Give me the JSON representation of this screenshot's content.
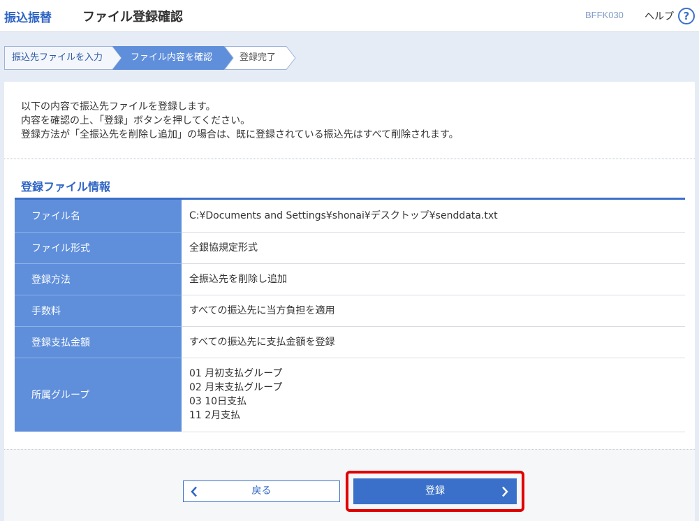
{
  "header": {
    "brand": "振込振替",
    "title": "ファイル登録確認",
    "screen_id": "BFFK030",
    "help_label": "ヘルプ",
    "help_icon": "?"
  },
  "steps": [
    {
      "label": "振込先ファイルを入力",
      "state": "done"
    },
    {
      "label": "ファイル内容を確認",
      "state": "current"
    },
    {
      "label": "登録完了",
      "state": "todo"
    }
  ],
  "intro": {
    "line1": "以下の内容で振込先ファイルを登録します。",
    "line2": "内容を確認の上、「登録」ボタンを押してください。",
    "line3": "登録方法が「全振込先を削除し追加」の場合は、既に登録されている振込先はすべて削除されます。"
  },
  "section": {
    "title": "登録ファイル情報"
  },
  "info_rows": [
    {
      "label": "ファイル名",
      "value": "C:¥Documents and Settings¥shonai¥デスクトップ¥senddata.txt"
    },
    {
      "label": "ファイル形式",
      "value": "全銀協規定形式"
    },
    {
      "label": "登録方法",
      "value": "全振込先を削除し追加"
    },
    {
      "label": "手数料",
      "value": "すべての振込先に当方負担を適用"
    },
    {
      "label": "登録支払金額",
      "value": "すべての振込先に支払金額を登録"
    }
  ],
  "group_row": {
    "label": "所属グループ",
    "values": [
      "01 月初支払グループ",
      "02 月末支払グループ",
      "03 10日支払",
      "11 2月支払"
    ]
  },
  "buttons": {
    "back": "戻る",
    "register": "登録"
  },
  "colors": {
    "accent": "#3a70c9",
    "table_header": "#5f8fdb",
    "highlight": "#e00000"
  }
}
